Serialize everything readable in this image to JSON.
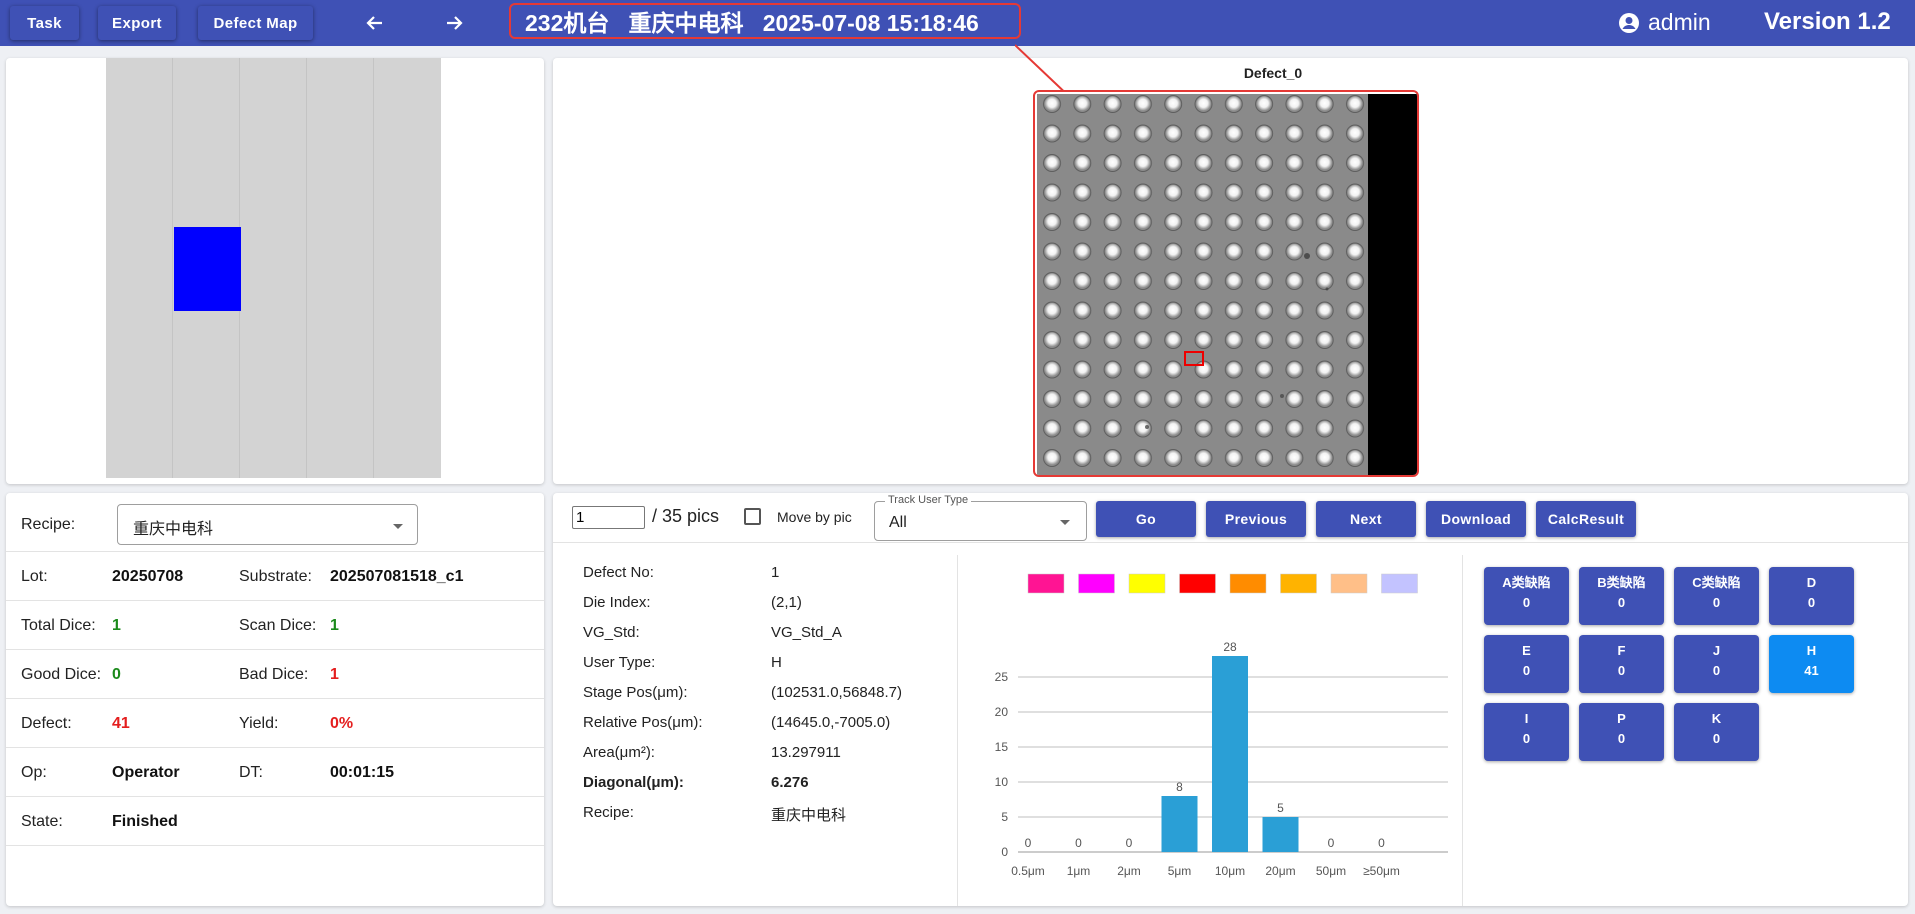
{
  "topbar": {
    "task_label": "Task",
    "export_label": "Export",
    "defect_map_label": "Defect Map",
    "title": "232机台   重庆中电科   2025-07-08 15:18:46",
    "user": "admin",
    "version": "Version 1.2"
  },
  "image_panel": {
    "title": "Defect_0"
  },
  "info": {
    "recipe_label": "Recipe:",
    "recipe_value": "重庆中电科",
    "lot_label": "Lot:",
    "lot_value": "20250708",
    "substrate_label": "Substrate:",
    "substrate_value": "202507081518_c1",
    "total_dice_label": "Total Dice:",
    "total_dice_value": "1",
    "scan_dice_label": "Scan Dice:",
    "scan_dice_value": "1",
    "good_dice_label": "Good Dice:",
    "good_dice_value": "0",
    "bad_dice_label": "Bad Dice:",
    "bad_dice_value": "1",
    "defect_label": "Defect:",
    "defect_value": "41",
    "yield_label": "Yield:",
    "yield_value": "0%",
    "op_label": "Op:",
    "op_value": "Operator",
    "dt_label": "DT:",
    "dt_value": "00:01:15",
    "state_label": "State:",
    "state_value": "Finished"
  },
  "controls": {
    "page_value": "1",
    "page_total": "/ 35 pics",
    "move_by_pic_label": "Move by pic",
    "track_user_type_label": "Track User Type",
    "track_user_type_value": "All",
    "go_label": "Go",
    "previous_label": "Previous",
    "next_label": "Next",
    "download_label": "Download",
    "calc_result_label": "CalcResult"
  },
  "details": [
    {
      "label": "Defect No:",
      "value": "1"
    },
    {
      "label": "Die Index:",
      "value": "(2,1)"
    },
    {
      "label": "VG_Std:",
      "value": "VG_Std_A"
    },
    {
      "label": "User Type:",
      "value": "H"
    },
    {
      "label": "Stage Pos(μm):",
      "value": "(102531.0,56848.7)"
    },
    {
      "label": "Relative Pos(μm):",
      "value": "(14645.0,-7005.0)"
    },
    {
      "label": "Area(μm²):",
      "value": "13.297911"
    },
    {
      "label": "Diagonal(μm):",
      "value": "6.276"
    },
    {
      "label": "Recipe:",
      "value": "重庆中电科"
    }
  ],
  "colors": {
    "primary": "#3f51b5",
    "active": "#0d8bf2",
    "bar": "#2a9fd6",
    "die_highlight": "#0000ff",
    "legend": [
      "#ff1493",
      "#ff00ff",
      "#ffff00",
      "#ff0000",
      "#ff8c00",
      "#ffb300",
      "#ffbf88",
      "#c3c3ff"
    ]
  },
  "chart_data": {
    "type": "bar",
    "categories": [
      "0.5μm",
      "1μm",
      "2μm",
      "5μm",
      "10μm",
      "20μm",
      "50μm",
      "≥50μm"
    ],
    "values": [
      0,
      0,
      0,
      8,
      28,
      5,
      0,
      0
    ],
    "yticks": [
      0,
      5,
      10,
      15,
      20,
      25
    ],
    "ylim": [
      0,
      28
    ],
    "grid": true
  },
  "classes": [
    {
      "name": "A类缺陷",
      "count": "0",
      "active": false
    },
    {
      "name": "B类缺陷",
      "count": "0",
      "active": false
    },
    {
      "name": "C类缺陷",
      "count": "0",
      "active": false
    },
    {
      "name": "D",
      "count": "0",
      "active": false
    },
    {
      "name": "E",
      "count": "0",
      "active": false
    },
    {
      "name": "F",
      "count": "0",
      "active": false
    },
    {
      "name": "J",
      "count": "0",
      "active": false
    },
    {
      "name": "H",
      "count": "41",
      "active": true
    },
    {
      "name": "I",
      "count": "0",
      "active": false
    },
    {
      "name": "P",
      "count": "0",
      "active": false
    },
    {
      "name": "K",
      "count": "0",
      "active": false
    }
  ]
}
